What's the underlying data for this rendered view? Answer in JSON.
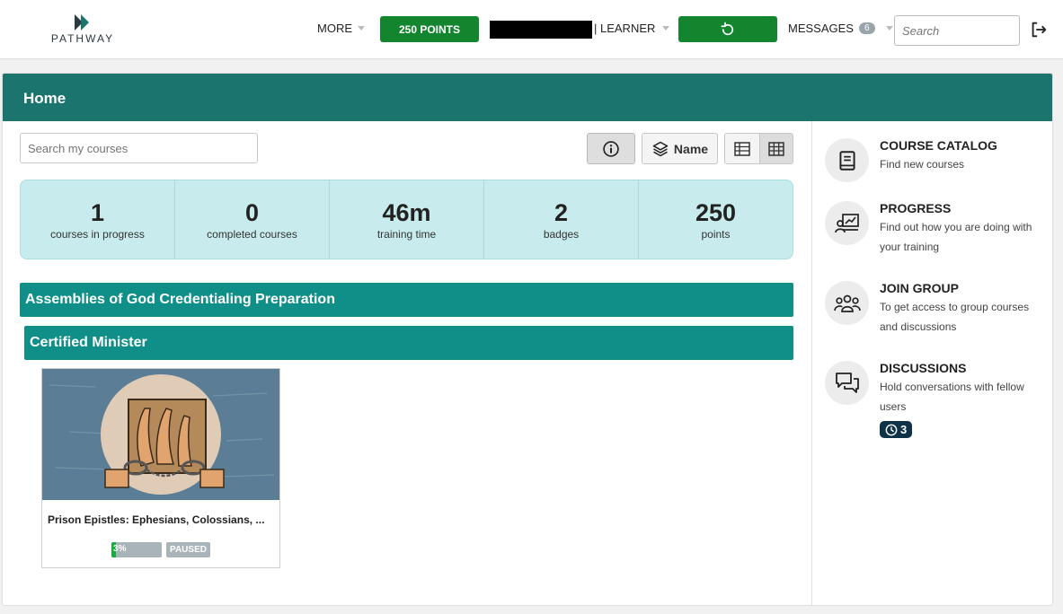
{
  "topbar": {
    "logo_text": "PATHWAY",
    "more_label": "MORE",
    "points_label": "250 POINTS",
    "role_label": "| LEARNER",
    "messages_label": "MESSAGES",
    "messages_count": "6",
    "search_placeholder": "Search"
  },
  "page": {
    "title": "Home",
    "search_placeholder": "Search my courses",
    "sort_label": "Name"
  },
  "stats": [
    {
      "value": "1",
      "label": "courses in progress"
    },
    {
      "value": "0",
      "label": "completed courses"
    },
    {
      "value": "46m",
      "label": "training time"
    },
    {
      "value": "2",
      "label": "badges"
    },
    {
      "value": "250",
      "label": "points"
    }
  ],
  "group": {
    "title": "Assemblies of God Credentialing Preparation",
    "subgroup": "Certified Minister"
  },
  "course": {
    "title": "Prison Epistles: Ephesians, Colossians, ...",
    "progress_label": "3%",
    "progress_value": 3,
    "status": "PAUSED"
  },
  "sidebar": {
    "catalog": {
      "title": "COURSE CATALOG",
      "desc": "Find new courses"
    },
    "progress": {
      "title": "PROGRESS",
      "desc": "Find out how you are doing with your training"
    },
    "join": {
      "title": "JOIN GROUP",
      "desc": "To get access to group courses and discussions"
    },
    "discussions": {
      "title": "DISCUSSIONS",
      "desc": "Hold conversations with fellow users",
      "badge": "3"
    }
  },
  "colors": {
    "header": "#1c746f",
    "group_bar": "#108f89",
    "primary_green": "#13852f",
    "stats_bg": "#c8eced"
  }
}
